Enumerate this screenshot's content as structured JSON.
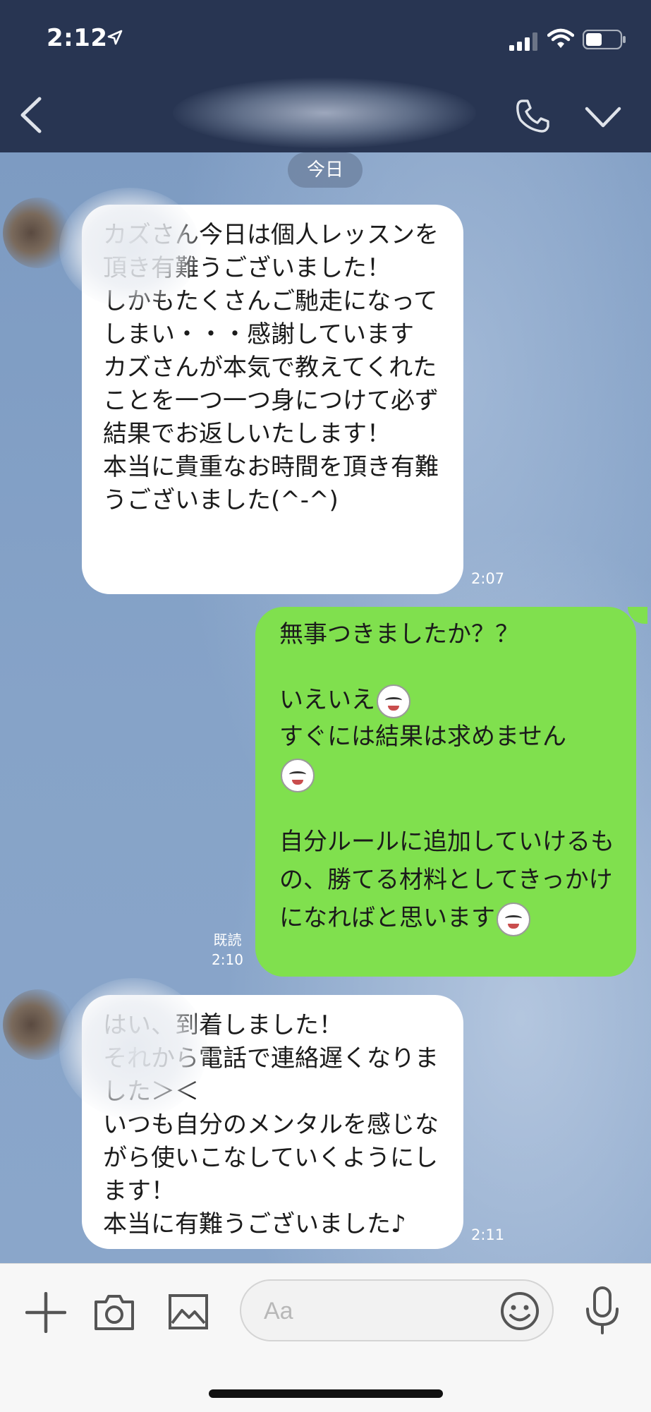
{
  "status_bar": {
    "time": "2:12"
  },
  "chat": {
    "date_label": "今日",
    "messages": [
      {
        "side": "incoming",
        "text": "カズさん今日は個人レッスンを頂き有難うございました！\nしかもたくさんご馳走になってしまい・・・感謝しています\nカズさんが本気で教えてくれたことを一つ一つ身につけて必ず結果でお返しいたします！\n本当に貴重なお時間を頂き有難うございました(^-^)",
        "time": "2:07"
      },
      {
        "side": "outgoing",
        "line1": "無事つきましたか？？",
        "line2": "いえいえ",
        "line3": "すぐには結果は求めません",
        "line4": "自分ルールに追加していけるもの、勝てる材料としてきっかけになればと思います",
        "read_label": "既読",
        "time": "2:10",
        "emoji": [
          "laughing-face-emoji",
          "laughing-face-emoji",
          "smiling-face-emoji"
        ]
      },
      {
        "side": "incoming",
        "text": "はい、到着しました！\nそれから電話で連絡遅くなりました＞＜\nいつも自分のメンタルを感じながら使いこなしていくようにします！\n本当に有難うございました♪",
        "time": "2:11"
      }
    ]
  },
  "input": {
    "placeholder": "Aa",
    "value": ""
  },
  "icons": {
    "header": [
      "back-chevron-icon",
      "phone-icon",
      "chevron-down-icon"
    ],
    "input_bar": [
      "plus-icon",
      "camera-icon",
      "image-icon",
      "emoji-icon",
      "microphone-icon"
    ]
  },
  "colors": {
    "header": "#283552",
    "outgoing_bubble": "#80e04e",
    "incoming_bubble": "#ffffff",
    "chat_background": "#7f9dc4"
  }
}
